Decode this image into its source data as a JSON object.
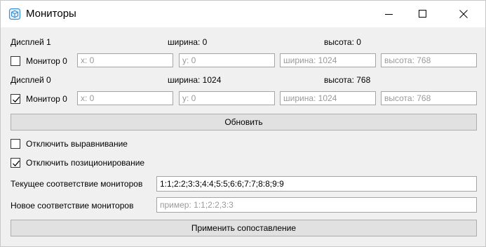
{
  "window": {
    "title": "Мониторы",
    "icon": "cube-icon"
  },
  "monitors": [
    {
      "display_label": "Дисплей 1",
      "width_label": "ширина: 0",
      "height_label": "высота: 0",
      "checkbox_label": "Монитор 0",
      "checked": false,
      "x_placeholder": "x: 0",
      "y_placeholder": "y: 0",
      "width_placeholder": "ширина: 1024",
      "height_placeholder": "высота: 768"
    },
    {
      "display_label": "Дисплей 0",
      "width_label": "ширина: 1024",
      "height_label": "высота: 768",
      "checkbox_label": "Монитор 0",
      "checked": true,
      "x_placeholder": "x: 0",
      "y_placeholder": "y: 0",
      "width_placeholder": "ширина: 1024",
      "height_placeholder": "высота: 768"
    }
  ],
  "refresh_button": "Обновить",
  "options": {
    "disable_alignment": {
      "label": "Отключить выравнивание",
      "checked": false
    },
    "disable_positioning": {
      "label": "Отключить позиционирование",
      "checked": true
    }
  },
  "mapping": {
    "current_label": "Текущее соответствие мониторов",
    "current_value": "1:1;2:2;3:3;4:4;5:5;6:6;7:7;8:8;9:9",
    "new_label": "Новое соответствие мониторов",
    "new_placeholder": "пример: 1:1;2:2,3:3",
    "new_value": ""
  },
  "apply_button": "Применить сопоставление"
}
